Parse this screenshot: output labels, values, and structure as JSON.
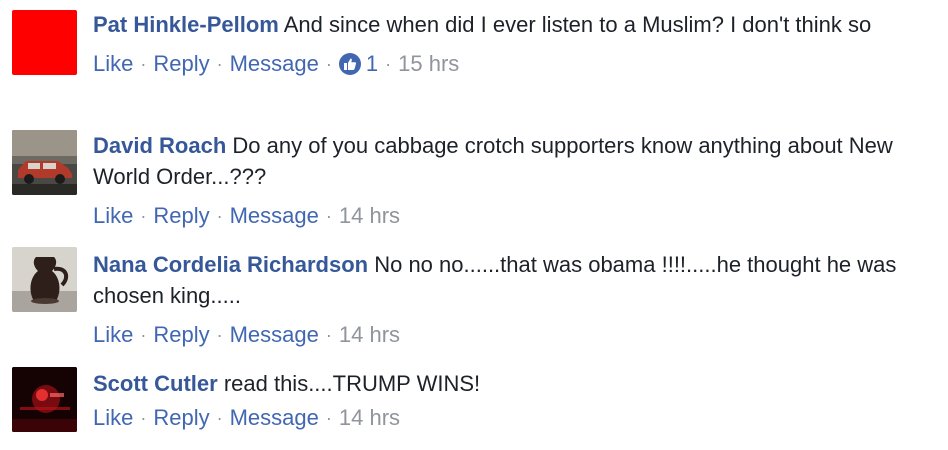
{
  "comments": [
    {
      "author": "Pat Hinkle-Pellom",
      "text": "And since when did I ever listen to a Muslim? I don't think so",
      "actions": {
        "like": "Like",
        "reply": "Reply",
        "message": "Message"
      },
      "reaction_count": "1",
      "time": "15 hrs",
      "avatar_color": "#ff0000"
    },
    {
      "author": "David Roach",
      "text": "Do any of you cabbage crotch supporters know anything about New World Order...???",
      "actions": {
        "like": "Like",
        "reply": "Reply",
        "message": "Message"
      },
      "time": "14 hrs"
    },
    {
      "author": "Nana Cordelia Richardson",
      "text": "No no no......that was obama !!!!.....he thought he was chosen king.....",
      "actions": {
        "like": "Like",
        "reply": "Reply",
        "message": "Message"
      },
      "time": "14 hrs"
    },
    {
      "author": "Scott Cutler",
      "text": "read this....TRUMP WINS!",
      "actions": {
        "like": "Like",
        "reply": "Reply",
        "message": "Message"
      },
      "time": "14 hrs"
    }
  ],
  "colors": {
    "link": "#365899",
    "action": "#4267b2",
    "meta": "#90949c",
    "text": "#1d2129"
  },
  "icons": {
    "reaction": "like-thumb-icon"
  }
}
